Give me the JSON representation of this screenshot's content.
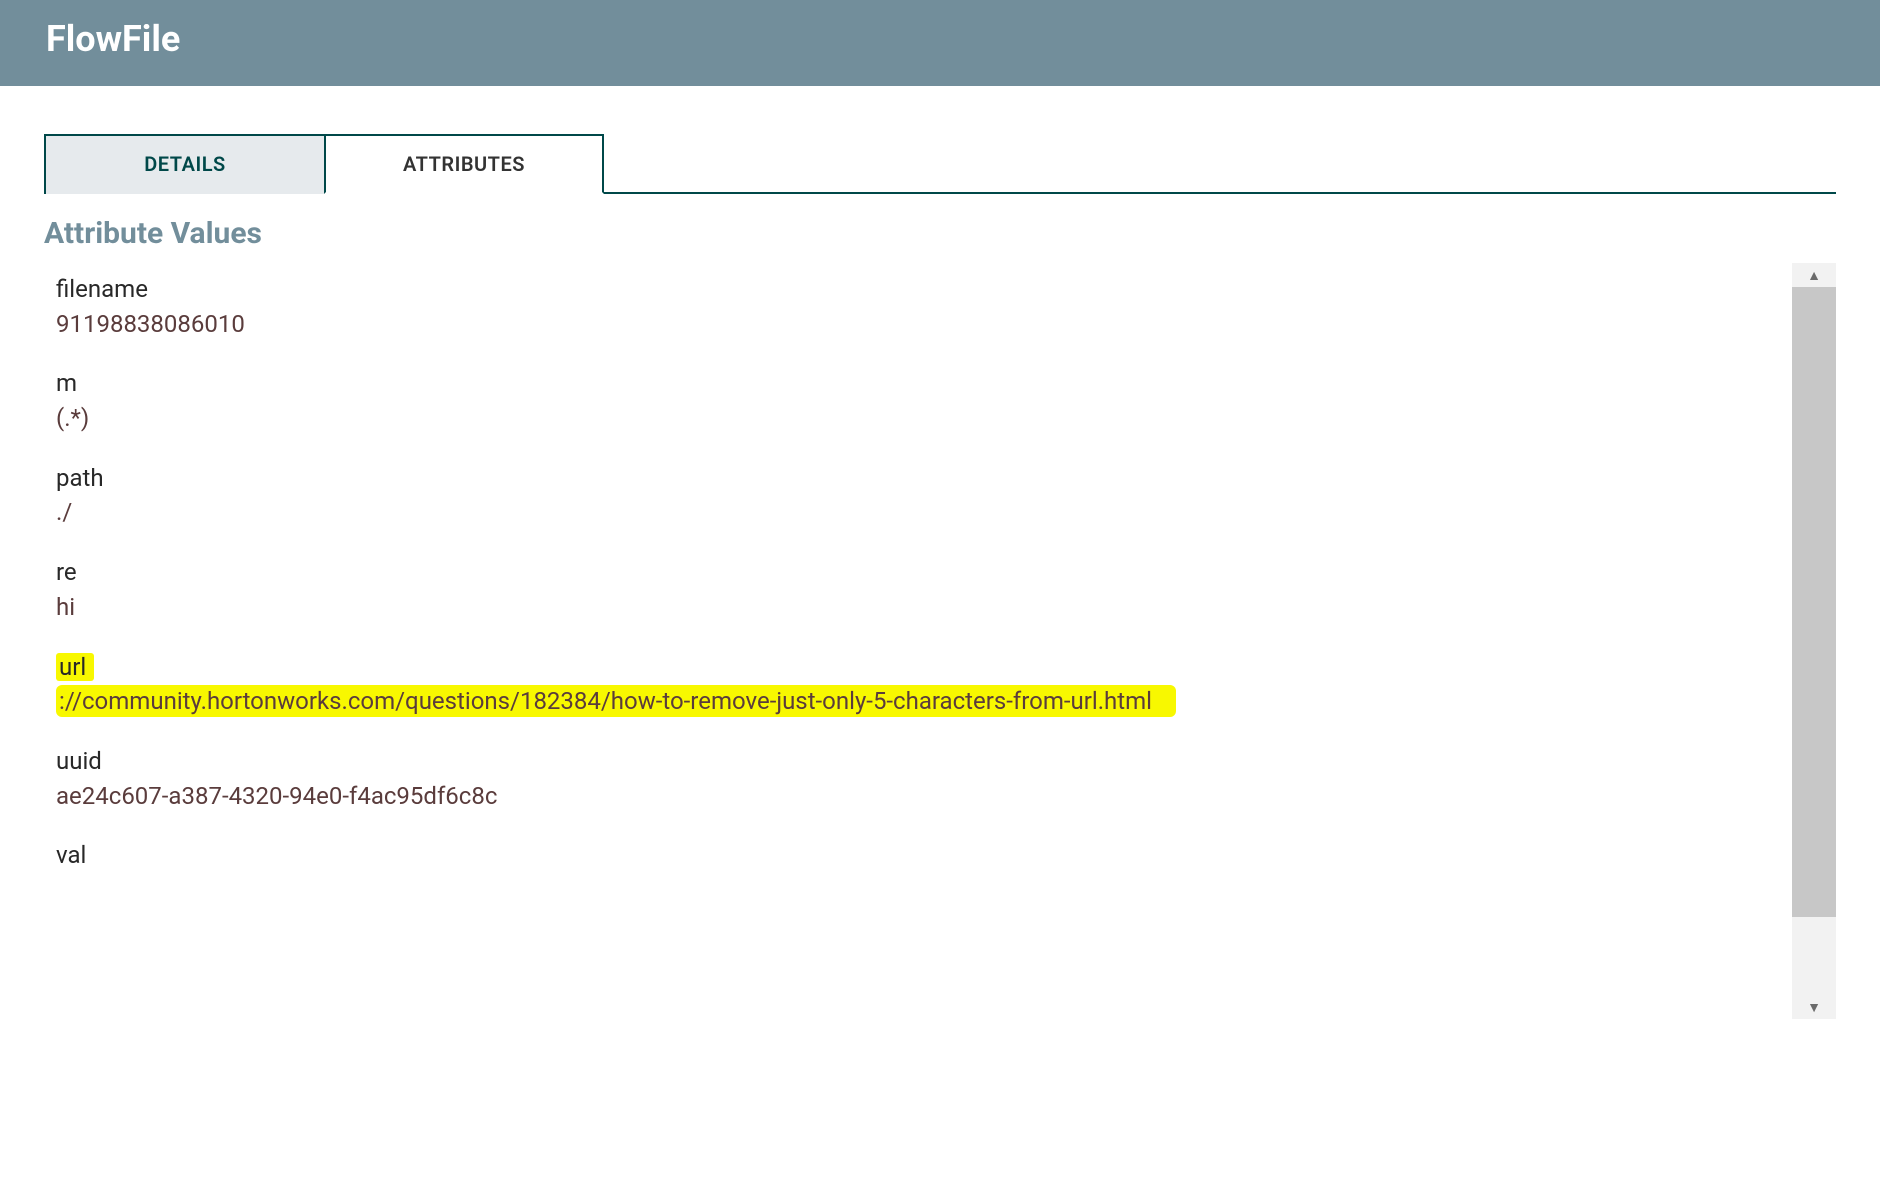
{
  "header": {
    "title": "FlowFile"
  },
  "tabs": {
    "details": "DETAILS",
    "attributes": "ATTRIBUTES"
  },
  "section": {
    "title": "Attribute Values"
  },
  "attributes": {
    "filename": {
      "name": "filename",
      "value": "91198838086010"
    },
    "m": {
      "name": "m",
      "value": "(.*)"
    },
    "path": {
      "name": "path",
      "value": "./"
    },
    "re": {
      "name": "re",
      "value": "hi"
    },
    "url": {
      "name": "url",
      "value": "://community.hortonworks.com/questions/182384/how-to-remove-just-only-5-characters-from-url.html"
    },
    "uuid": {
      "name": "uuid",
      "value": "ae24c607-a387-4320-94e0-f4ac95df6c8c"
    },
    "val": {
      "name": "val",
      "value": ""
    }
  }
}
